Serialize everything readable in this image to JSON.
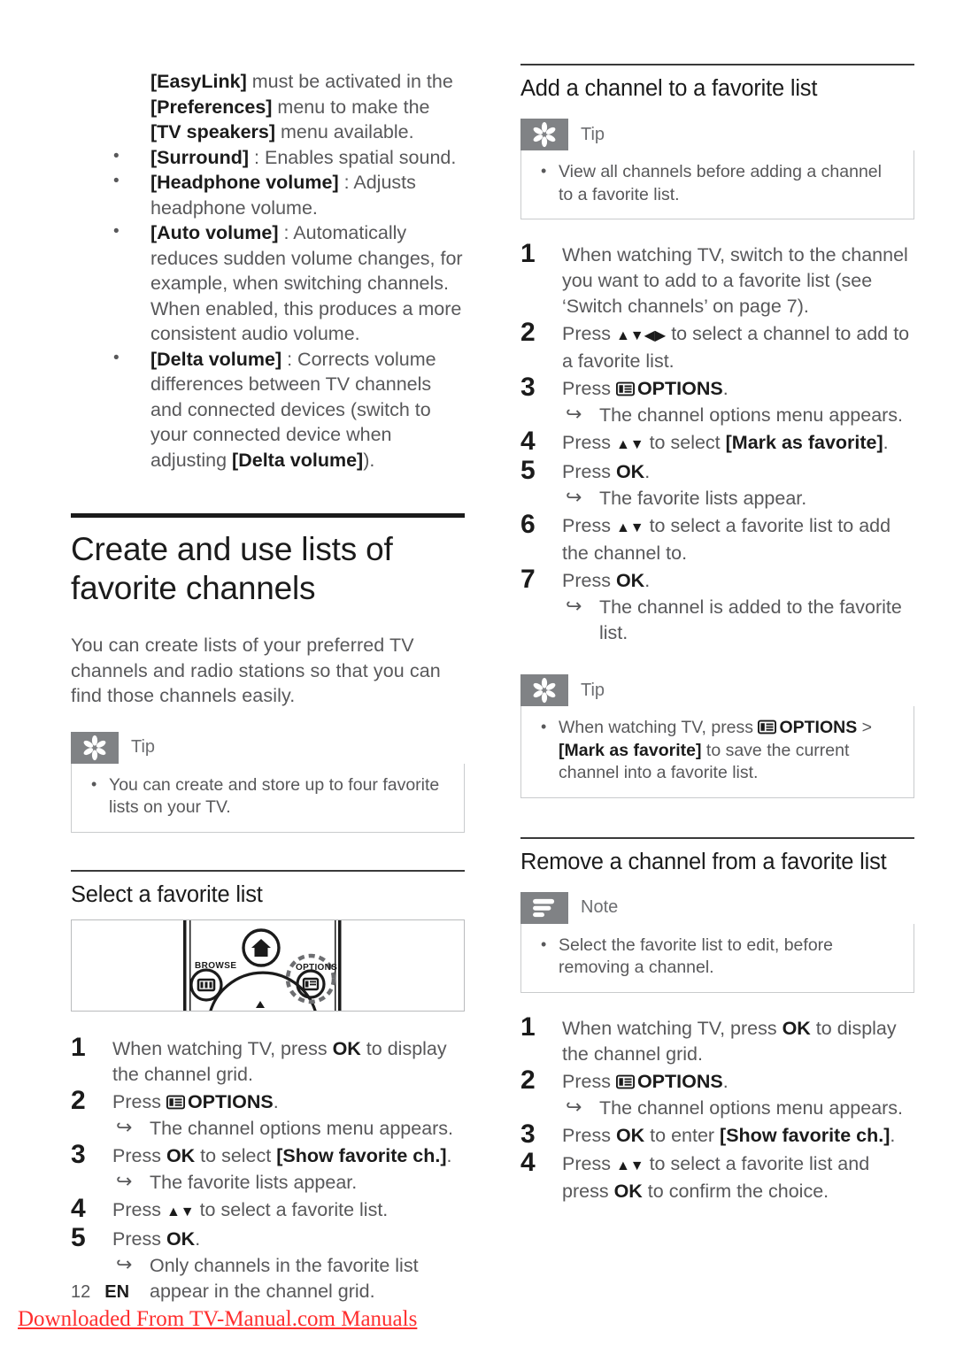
{
  "document": {
    "page_number": "12",
    "language_code": "EN",
    "watermark": "Downloaded From TV-Manual.com Manuals"
  },
  "left_column": {
    "intro_paragraph": {
      "lines": [
        {
          "bold": "[EasyLink]",
          "rest": " must be activated in the"
        },
        {
          "bold": "[Preferences]",
          "rest": " menu to make the"
        },
        {
          "bold": "[TV speakers]",
          "rest": " menu available."
        }
      ]
    },
    "sound_options": [
      {
        "term": "[Surround]",
        "desc": " : Enables spatial sound."
      },
      {
        "term": "[Headphone volume]",
        "desc": " : Adjusts headphone volume."
      },
      {
        "term": "[Auto volume]",
        "desc": " : Automatically reduces sudden volume changes, for example, when switching channels. When enabled, this produces a more consistent audio volume."
      },
      {
        "term": "[Delta volume]",
        "desc": " : Corrects volume differences between TV channels and connected devices (switch to your connected device when adjusting [Delta volume])."
      }
    ],
    "chapter_heading": "Create and use lists of favorite channels",
    "chapter_intro": "You can create lists of your preferred TV channels and radio stations so that you can find those channels easily.",
    "tip_box": {
      "label": "Tip",
      "icon": "tip-asterisk-icon",
      "items": [
        "You can create and store up to four favorite lists on your TV."
      ]
    },
    "section_heading": "Select a favorite list",
    "remote_figure": {
      "browse_label": "BROWSE",
      "options_label": "OPTIONS",
      "home_icon": "home-icon",
      "browse_icon": "browse-icon",
      "options_icon": "options-icon",
      "up_arrow_icon": "up-arrow-icon"
    },
    "steps": [
      {
        "num": "1",
        "text_parts": [
          {
            "t": "When watching TV, press "
          },
          {
            "t": "OK",
            "bold": true
          },
          {
            "t": " to display the channel grid."
          }
        ]
      },
      {
        "num": "2",
        "icon": "options-icon",
        "text_parts": [
          {
            "t": "Press "
          },
          {
            "t": "options-glyph",
            "glyph": true
          },
          {
            "t": "OPTIONS",
            "bold": true
          },
          {
            "t": "."
          }
        ],
        "result": "The channel options menu appears."
      },
      {
        "num": "3",
        "text_parts": [
          {
            "t": "Press "
          },
          {
            "t": "OK",
            "bold": true
          },
          {
            "t": " to select "
          },
          {
            "t": "[Show favorite ch.]",
            "bold": true
          },
          {
            "t": "."
          }
        ],
        "result": "The favorite lists appear."
      },
      {
        "num": "4",
        "text_parts": [
          {
            "t": "Press "
          },
          {
            "t": "▲▼",
            "arrows": true
          },
          {
            "t": " to select a favorite list."
          }
        ]
      },
      {
        "num": "5",
        "text_parts": [
          {
            "t": "Press "
          },
          {
            "t": "OK",
            "bold": true
          },
          {
            "t": "."
          }
        ],
        "result": "Only channels in the favorite list appear in the channel grid."
      }
    ]
  },
  "right_column": {
    "section_heading_add": "Add a channel to a favorite list",
    "tip_box_add": {
      "label": "Tip",
      "icon": "tip-asterisk-icon",
      "items": [
        "View all channels before adding a channel to a favorite list."
      ]
    },
    "steps_add": [
      {
        "num": "1",
        "text_parts": [
          {
            "t": "When watching TV, switch to the channel you want to add to a favorite list (see ‘Switch channels’ on page 7)."
          }
        ]
      },
      {
        "num": "2",
        "text_parts": [
          {
            "t": "Press "
          },
          {
            "t": "▲▼◀▶",
            "arrows": true
          },
          {
            "t": " to select a channel to add to a favorite list."
          }
        ]
      },
      {
        "num": "3",
        "text_parts": [
          {
            "t": "Press "
          },
          {
            "t": "options-glyph",
            "glyph": true
          },
          {
            "t": "OPTIONS",
            "bold": true
          },
          {
            "t": "."
          }
        ],
        "result": "The channel options menu appears."
      },
      {
        "num": "4",
        "text_parts": [
          {
            "t": "Press "
          },
          {
            "t": "▲▼",
            "arrows": true
          },
          {
            "t": " to select "
          },
          {
            "t": "[Mark as favorite]",
            "bold": true
          },
          {
            "t": "."
          }
        ]
      },
      {
        "num": "5",
        "text_parts": [
          {
            "t": "Press "
          },
          {
            "t": "OK",
            "bold": true
          },
          {
            "t": "."
          }
        ],
        "result": "The favorite lists appear."
      },
      {
        "num": "6",
        "text_parts": [
          {
            "t": "Press "
          },
          {
            "t": "▲▼",
            "arrows": true
          },
          {
            "t": " to select a favorite list to add the channel to."
          }
        ]
      },
      {
        "num": "7",
        "text_parts": [
          {
            "t": "Press "
          },
          {
            "t": "OK",
            "bold": true
          },
          {
            "t": "."
          }
        ],
        "result": "The channel is added to the favorite list."
      }
    ],
    "tip_box_mark": {
      "label": "Tip",
      "icon": "tip-asterisk-icon",
      "text_parts": [
        {
          "t": "When watching TV, press "
        },
        {
          "t": "options-glyph",
          "glyph": true
        },
        {
          "t": "OPTIONS",
          "bold": true
        },
        {
          "t": " > "
        },
        {
          "t": "[Mark as favorite]",
          "bold": true
        },
        {
          "t": " to save the current channel into a favorite list."
        }
      ]
    },
    "section_heading_remove": "Remove a channel from a favorite list",
    "note_box": {
      "label": "Note",
      "icon": "note-lines-icon",
      "items": [
        "Select the favorite list to edit, before removing a channel."
      ]
    },
    "steps_remove": [
      {
        "num": "1",
        "text_parts": [
          {
            "t": "When watching TV, press "
          },
          {
            "t": "OK",
            "bold": true
          },
          {
            "t": " to display the channel grid."
          }
        ]
      },
      {
        "num": "2",
        "text_parts": [
          {
            "t": "Press "
          },
          {
            "t": "options-glyph",
            "glyph": true
          },
          {
            "t": "OPTIONS",
            "bold": true
          },
          {
            "t": "."
          }
        ],
        "result": "The channel options menu appears."
      },
      {
        "num": "3",
        "text_parts": [
          {
            "t": "Press "
          },
          {
            "t": "OK",
            "bold": true
          },
          {
            "t": " to enter "
          },
          {
            "t": "[Show favorite ch.]",
            "bold": true
          },
          {
            "t": "."
          }
        ]
      },
      {
        "num": "4",
        "text_parts": [
          {
            "t": "Press "
          },
          {
            "t": "▲▼",
            "arrows": true
          },
          {
            "t": " to select a favorite list and press "
          },
          {
            "t": "OK",
            "bold": true
          },
          {
            "t": " to confirm the choice."
          }
        ]
      }
    ]
  },
  "colors": {
    "badge_gray": "#808285",
    "body_text": "#58585a",
    "heading_black": "#1b1b1b",
    "box_border": "#c9cbcd",
    "watermark_red": "#ff2d2d"
  }
}
